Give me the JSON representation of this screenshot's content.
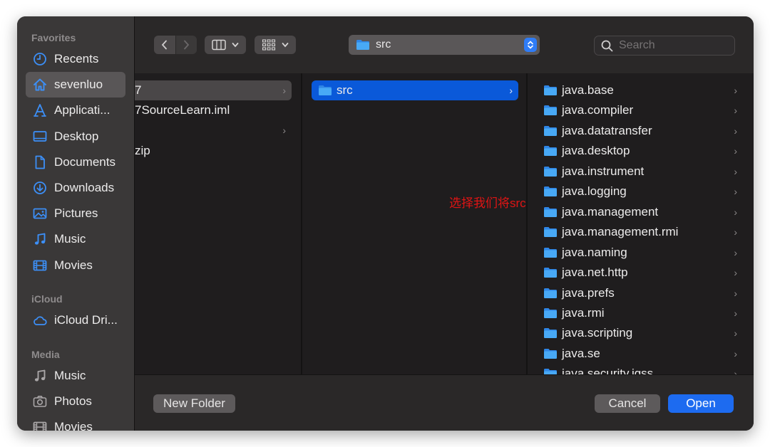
{
  "sidebar": {
    "sections": [
      {
        "title": "Favorites",
        "items": [
          {
            "label": "Recents",
            "icon": "clock-icon"
          },
          {
            "label": "sevenluo",
            "icon": "home-icon",
            "selected": true
          },
          {
            "label": "Applicati...",
            "icon": "applications-icon"
          },
          {
            "label": "Desktop",
            "icon": "desktop-icon"
          },
          {
            "label": "Documents",
            "icon": "document-icon"
          },
          {
            "label": "Downloads",
            "icon": "download-icon"
          },
          {
            "label": "Pictures",
            "icon": "pictures-icon"
          },
          {
            "label": "Music",
            "icon": "music-icon"
          },
          {
            "label": "Movies",
            "icon": "movies-icon"
          }
        ]
      },
      {
        "title": "iCloud",
        "items": [
          {
            "label": "iCloud Dri...",
            "icon": "cloud-icon"
          }
        ]
      },
      {
        "title": "Media",
        "items": [
          {
            "label": "Music",
            "icon": "music-icon"
          },
          {
            "label": "Photos",
            "icon": "camera-icon"
          },
          {
            "label": "Movies",
            "icon": "movies-icon"
          }
        ]
      }
    ]
  },
  "toolbar": {
    "path_label": "src",
    "search_placeholder": "Search"
  },
  "columns": {
    "col1": [
      {
        "label": "7",
        "has_children": true,
        "highlighted": true
      },
      {
        "label": "7SourceLearn.iml",
        "has_children": false
      },
      {
        "label": "",
        "has_children": true
      },
      {
        "label": "zip",
        "has_children": false
      }
    ],
    "col2": [
      {
        "label": "src",
        "has_children": true,
        "selected": true
      }
    ],
    "col3": [
      "java.base",
      "java.compiler",
      "java.datatransfer",
      "java.desktop",
      "java.instrument",
      "java.logging",
      "java.management",
      "java.management.rmi",
      "java.naming",
      "java.net.http",
      "java.prefs",
      "java.rmi",
      "java.scripting",
      "java.se",
      "java.security.jgss"
    ]
  },
  "annotation": "选择我们将src.zip解压后的源码目录",
  "footer": {
    "new_folder": "New Folder",
    "cancel": "Cancel",
    "open": "Open"
  },
  "colors": {
    "accent": "#1d6bf0",
    "selection": "#0a59d9",
    "folder": "#3ea2f4",
    "annotation": "#e01414"
  }
}
